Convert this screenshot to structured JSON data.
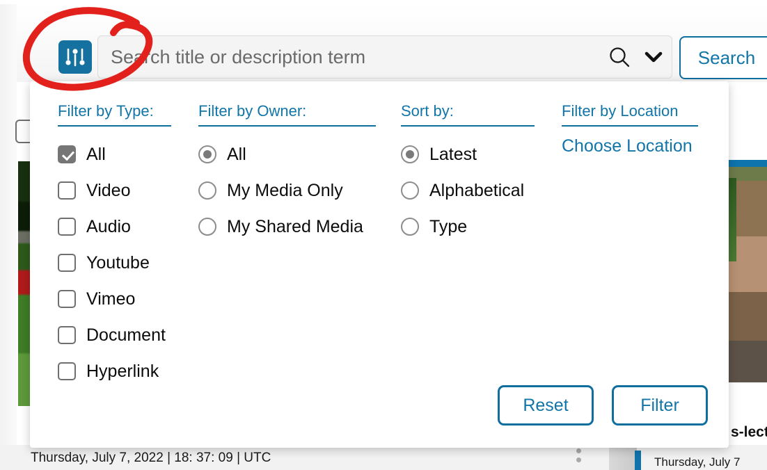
{
  "header": {
    "filter_toggle_icon": "sliders-icon",
    "search_magnifier_icon": "search-icon",
    "search_chevron_icon": "chevron-down-icon",
    "search_placeholder": "Search title or description term",
    "search_value": "",
    "search_button_label": "Search"
  },
  "filter_panel": {
    "type_column": {
      "heading": "Filter by Type:",
      "options": [
        {
          "label": "All",
          "checked": true
        },
        {
          "label": "Video",
          "checked": false
        },
        {
          "label": "Audio",
          "checked": false
        },
        {
          "label": "Youtube",
          "checked": false
        },
        {
          "label": "Vimeo",
          "checked": false
        },
        {
          "label": "Document",
          "checked": false
        },
        {
          "label": "Hyperlink",
          "checked": false
        }
      ]
    },
    "owner_column": {
      "heading": "Filter by Owner:",
      "options": [
        {
          "label": "All",
          "selected": true
        },
        {
          "label": "My Media Only",
          "selected": false
        },
        {
          "label": "My Shared Media",
          "selected": false
        }
      ]
    },
    "sort_column": {
      "heading": "Sort by:",
      "options": [
        {
          "label": "Latest",
          "selected": true
        },
        {
          "label": "Alphabetical",
          "selected": false
        },
        {
          "label": "Type",
          "selected": false
        }
      ]
    },
    "location_column": {
      "heading": "Filter by Location",
      "link_label": "Choose Location"
    },
    "reset_button_label": "Reset",
    "filter_button_label": "Filter"
  },
  "background": {
    "left_card_timestamp": "Thursday, July 7, 2022 | 18: 37: 09 | UTC",
    "right_card_title": "s-lect",
    "right_card_timestamp": "Thursday, July 7",
    "kebab_icon": "more-vertical-icon"
  },
  "annotation": {
    "shape": "hand-drawn-circle",
    "color": "#E2211C"
  },
  "colors": {
    "accent_blue": "#1275a8",
    "rule_blue": "#0e6e9e",
    "icon_blue": "#15719f",
    "annotation_red": "#E2211C",
    "checkbox_checked": "#767676"
  }
}
